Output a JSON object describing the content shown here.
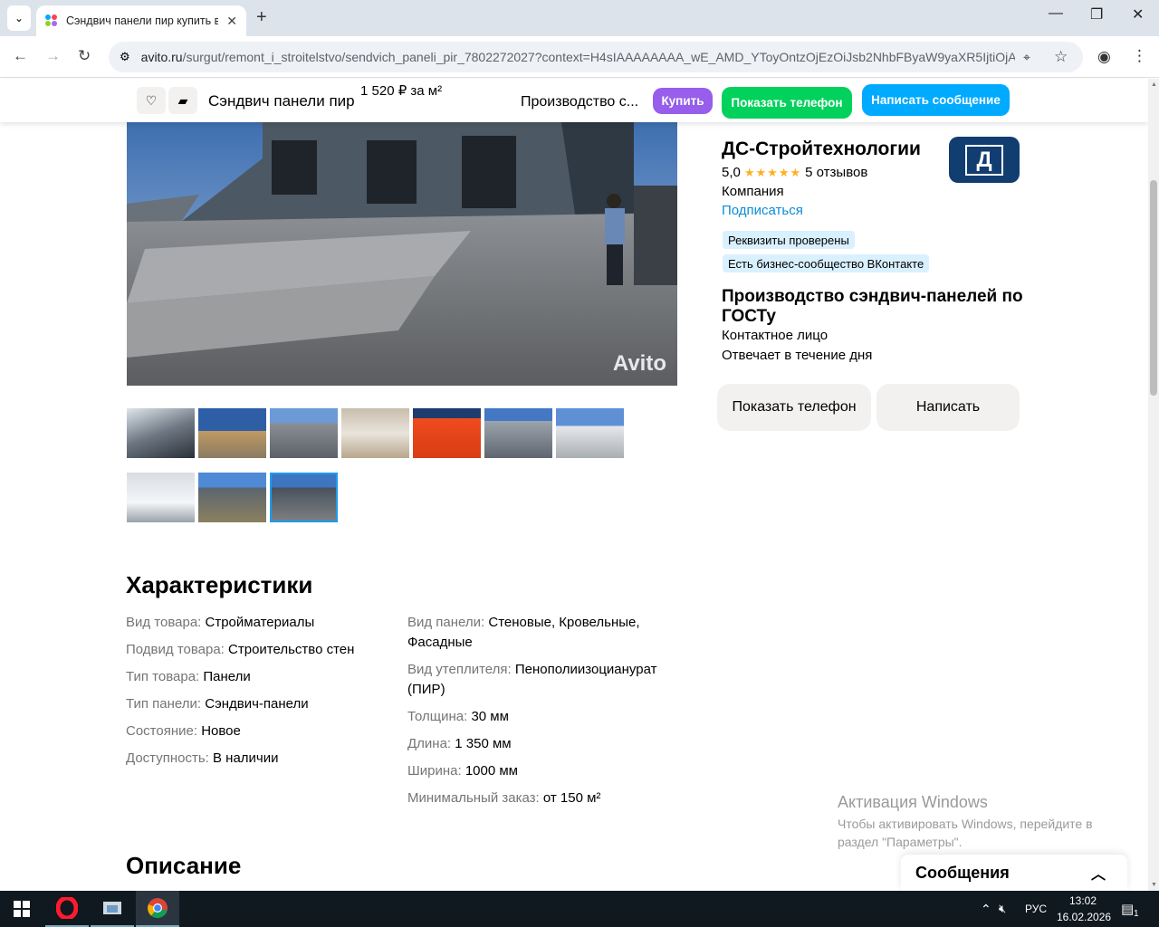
{
  "browser": {
    "tab_title": "Сэндвич панели пир купить в",
    "url_host": "avito.ru",
    "url_path": "/surgut/remont_i_stroitelstvo/sendvich_paneli_pir_7802272027?context=H4sIAAAAAAAA_wE_AMD_YToyOntzOjEzOiJsb2NhbFByaW9yaXR5IjtiOjA7c..."
  },
  "sticky": {
    "title": "Сэндвич панели пир",
    "price": "1 520 ₽ за м²",
    "seller": "Производство с...",
    "buy_label": "Купить",
    "phone_label": "Показать телефон",
    "message_label": "Написать сообщение"
  },
  "photo": {
    "watermark": "Avito"
  },
  "seller": {
    "name": "ДС-Стройтехнологии",
    "rating": "5,0",
    "stars": "★★★★★",
    "reviews": "5 отзывов",
    "type": "Компания",
    "subscribe": "Подписаться",
    "badges": [
      "Реквизиты проверены",
      "Есть бизнес-сообщество ВКонтакте"
    ],
    "headline": "Производство сэндвич-панелей по ГОСТу",
    "contact": "Контактное лицо",
    "response": "Отвечает в течение дня",
    "logo_letter": "Д",
    "show_phone": "Показать телефон",
    "write": "Написать"
  },
  "characteristics": {
    "title": "Характеристики",
    "left": [
      {
        "k": "Вид товара:",
        "v": "Стройматериалы"
      },
      {
        "k": "Подвид товара:",
        "v": "Строительство стен"
      },
      {
        "k": "Тип товара:",
        "v": "Панели"
      },
      {
        "k": "Тип панели:",
        "v": "Сэндвич-панели"
      },
      {
        "k": "Состояние:",
        "v": "Новое"
      },
      {
        "k": "Доступность:",
        "v": "В наличии"
      }
    ],
    "right": [
      {
        "k": "Вид панели:",
        "v": "Стеновые, Кровельные, Фасадные"
      },
      {
        "k": "Вид утеплителя:",
        "v": "Пенополиизоцианурат (ПИР)"
      },
      {
        "k": "Толщина:",
        "v": "30 мм"
      },
      {
        "k": "Длина:",
        "v": "1 350 мм"
      },
      {
        "k": "Ширина:",
        "v": "1000 мм"
      },
      {
        "k": "Минимальный заказ:",
        "v": "от 150 м²"
      }
    ]
  },
  "description": {
    "title": "Описание"
  },
  "windows": {
    "activation_title": "Активация Windows",
    "activation_text": "Чтобы активировать Windows, перейдите в раздел \"Параметры\".",
    "messages": "Сообщения",
    "lang": "РУС",
    "time": "13:02",
    "date": "16.02.2026",
    "notif_count": "1"
  },
  "colors": {
    "buy": "#965eeb",
    "phone": "#02d15c",
    "message": "#00aaff",
    "link": "#0a8cd7"
  }
}
